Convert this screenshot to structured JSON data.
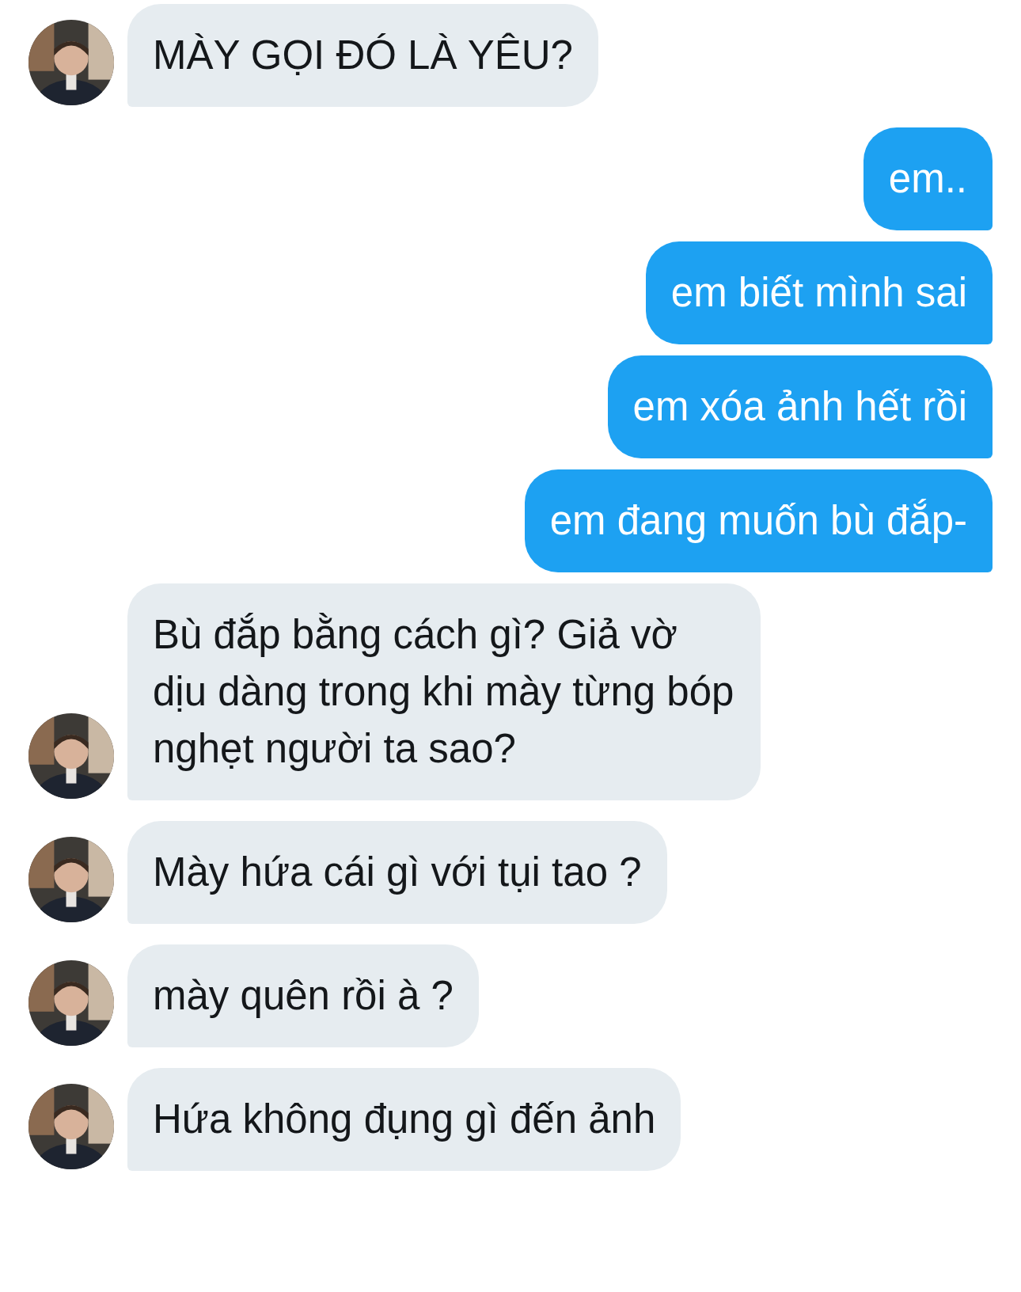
{
  "messages": [
    {
      "kind": "incoming",
      "text": "MÀY GỌI ĐÓ LÀ YÊU?"
    },
    {
      "kind": "outgoing",
      "text": "em.."
    },
    {
      "kind": "outgoing",
      "text": "em biết mình sai"
    },
    {
      "kind": "outgoing",
      "text": "em xóa ảnh hết rồi"
    },
    {
      "kind": "outgoing",
      "text": "em đang muốn bù đắp-"
    },
    {
      "kind": "incoming",
      "text": "Bù đắp bằng cách gì? Giả vờ dịu dàng trong khi mày từng bóp nghẹt người ta sao?"
    },
    {
      "kind": "incoming",
      "text": "Mày hứa cái gì với tụi tao ?"
    },
    {
      "kind": "incoming",
      "text": "mày quên rồi à ?"
    },
    {
      "kind": "incoming",
      "text": "Hứa không đụng gì đến ảnh"
    }
  ]
}
